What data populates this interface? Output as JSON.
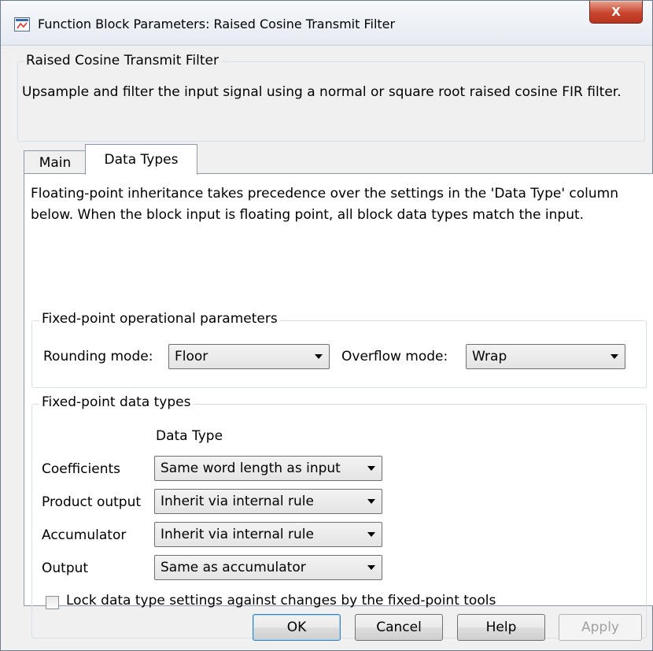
{
  "window": {
    "title": "Function Block Parameters: Raised Cosine Transmit Filter",
    "close_label": "X"
  },
  "description": {
    "group_title": "Raised Cosine Transmit Filter",
    "text": "Upsample and filter the input signal using a normal or square root raised cosine FIR filter."
  },
  "tabs": [
    {
      "label": "Main",
      "active": false
    },
    {
      "label": "Data Types",
      "active": true
    }
  ],
  "data_types_tab": {
    "intro_text": "Floating-point inheritance takes precedence over the settings in the 'Data Type' column below. When the block input is floating point, all block data types match the input.",
    "operational": {
      "group_title": "Fixed-point operational parameters",
      "rounding_label": "Rounding mode:",
      "rounding_value": "Floor",
      "overflow_label": "Overflow mode:",
      "overflow_value": "Wrap"
    },
    "data_types": {
      "group_title": "Fixed-point data types",
      "column_header": "Data Type",
      "rows": [
        {
          "label": "Coefficients",
          "value": "Same word length as input"
        },
        {
          "label": "Product output",
          "value": "Inherit via internal rule"
        },
        {
          "label": "Accumulator",
          "value": "Inherit via internal rule"
        },
        {
          "label": "Output",
          "value": "Same as accumulator"
        }
      ],
      "lock_label": "Lock data type settings against changes by the fixed-point tools",
      "lock_checked": false
    }
  },
  "buttons": {
    "ok": "OK",
    "cancel": "Cancel",
    "help": "Help",
    "apply": "Apply"
  },
  "colors": {
    "accent_blue": "#3c7fb1",
    "close_red": "#c9452e",
    "window_bg": "#f0f0f0"
  }
}
